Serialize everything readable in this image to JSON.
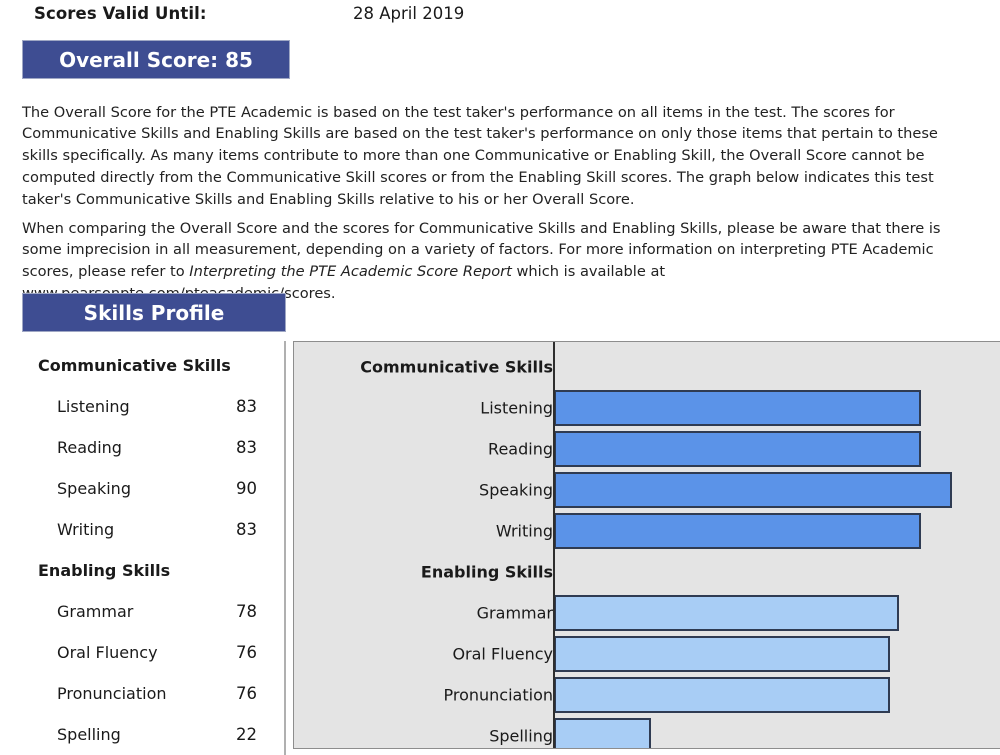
{
  "header": {
    "valid_until_label": "Scores Valid Until:",
    "valid_until_value": "28 April 2019",
    "overall_banner": "Overall Score: 85",
    "skills_banner": "Skills Profile"
  },
  "paragraphs": {
    "p1": "The Overall Score for the PTE Academic is based on the test taker's performance on all items in the test.  The scores for Communicative Skills and Enabling Skills are based on the test taker's performance on only those items that pertain to these skills specifically.  As many items contribute to more than one Communicative or Enabling Skill, the Overall Score cannot be computed directly from the Communicative Skill scores or from the Enabling Skill scores.  The graph below indicates this test taker's Communicative Skills and Enabling Skills relative to his or her Overall Score.",
    "p2_a": "When comparing the Overall Score and the scores for Communicative Skills and Enabling Skills, please be aware that there is some imprecision in all measurement, depending on a variety of factors.  For more information on interpreting PTE Academic scores, please refer to ",
    "p2_italic": "Interpreting the PTE Academic Score Report",
    "p2_b": " which is available at www.pearsonpte.com/pteacademic/scores."
  },
  "score_table": {
    "rows": [
      {
        "label": "Communicative Skills",
        "score": "",
        "type": "group"
      },
      {
        "label": "Listening",
        "score": "83",
        "type": "item"
      },
      {
        "label": "Reading",
        "score": "83",
        "type": "item"
      },
      {
        "label": "Speaking",
        "score": "90",
        "type": "item"
      },
      {
        "label": "Writing",
        "score": "83",
        "type": "item"
      },
      {
        "label": "Enabling Skills",
        "score": "",
        "type": "group"
      },
      {
        "label": "Grammar",
        "score": "78",
        "type": "item"
      },
      {
        "label": "Oral Fluency",
        "score": "76",
        "type": "item"
      },
      {
        "label": "Pronunciation",
        "score": "76",
        "type": "item"
      },
      {
        "label": "Spelling",
        "score": "22",
        "type": "item"
      }
    ]
  },
  "chart_data": {
    "type": "bar",
    "title": "Skills Profile",
    "orientation": "horizontal",
    "xlabel": "",
    "ylabel": "",
    "xlim": [
      0,
      100
    ],
    "grid": false,
    "legend_position": "none",
    "colors": {
      "communicative": "#5b93e8",
      "enabling": "#a8cdf5",
      "bar_border": "#2f3b52",
      "panel_background": "#e4e4e4",
      "banner": "#3e4d92"
    },
    "overall_score": 85,
    "groups": [
      {
        "name": "Communicative Skills",
        "series_color": "#5b93e8",
        "categories": [
          "Listening",
          "Reading",
          "Speaking",
          "Writing"
        ],
        "values": [
          83,
          83,
          90,
          83
        ]
      },
      {
        "name": "Enabling Skills",
        "series_color": "#a8cdf5",
        "categories": [
          "Grammar",
          "Oral Fluency",
          "Pronunciation",
          "Spelling"
        ],
        "values": [
          78,
          76,
          76,
          22
        ]
      }
    ],
    "rows": [
      {
        "label": "Communicative Skills",
        "value": null,
        "type": "group"
      },
      {
        "label": "Listening",
        "value": 83,
        "type": "communicative"
      },
      {
        "label": "Reading",
        "value": 83,
        "type": "communicative"
      },
      {
        "label": "Speaking",
        "value": 90,
        "type": "communicative"
      },
      {
        "label": "Writing",
        "value": 83,
        "type": "communicative"
      },
      {
        "label": "Enabling Skills",
        "value": null,
        "type": "group"
      },
      {
        "label": "Grammar",
        "value": 78,
        "type": "enabling"
      },
      {
        "label": "Oral Fluency",
        "value": 76,
        "type": "enabling"
      },
      {
        "label": "Pronunciation",
        "value": 76,
        "type": "enabling"
      },
      {
        "label": "Spelling",
        "value": 22,
        "type": "enabling"
      }
    ]
  }
}
